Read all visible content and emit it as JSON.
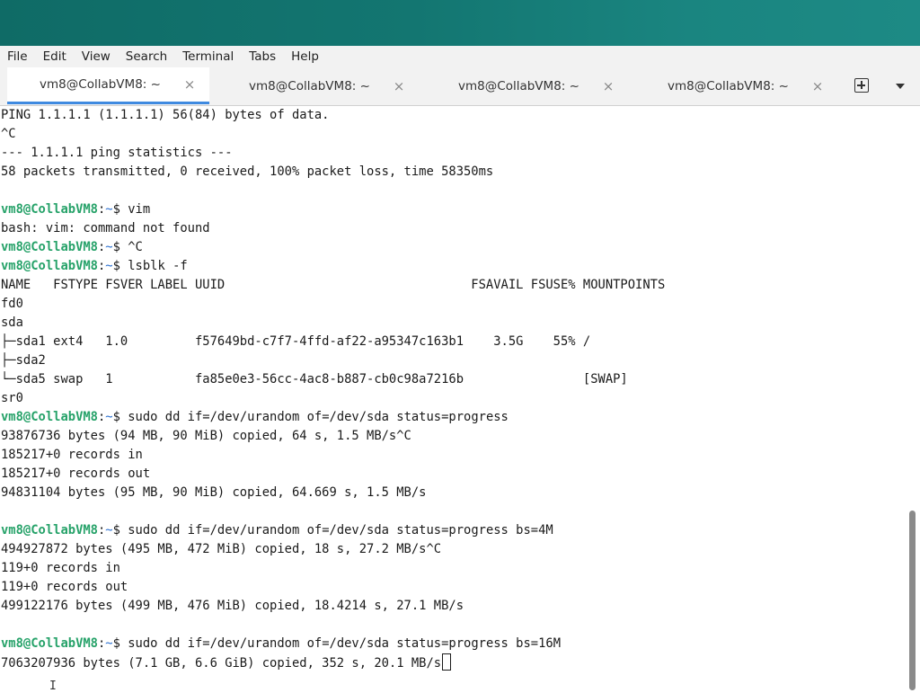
{
  "menu": [
    "File",
    "Edit",
    "View",
    "Search",
    "Terminal",
    "Tabs",
    "Help"
  ],
  "tabs": [
    {
      "label": "vm8@CollabVM8: ~",
      "active": true
    },
    {
      "label": "vm8@CollabVM8: ~",
      "active": false
    },
    {
      "label": "vm8@CollabVM8: ~",
      "active": false
    },
    {
      "label": "vm8@CollabVM8: ~",
      "active": false
    }
  ],
  "tab_close_glyph": "×",
  "icons": {
    "new_tab": "new-tab-icon",
    "tab_menu": "chevron-down-icon",
    "close": "close-icon"
  },
  "colors": {
    "accent": "#3f8ae0",
    "prompt_user": "#26a269",
    "prompt_path": "#2a6fd0",
    "titlebar": "#137671"
  },
  "prompt": {
    "user": "vm8@CollabVM8",
    "sep": ":",
    "path": "~",
    "sigil": "$ "
  },
  "terminal_lines": [
    {
      "text": "PING 1.1.1.1 (1.1.1.1) 56(84) bytes of data."
    },
    {
      "text": "^C"
    },
    {
      "text": "--- 1.1.1.1 ping statistics ---"
    },
    {
      "text": "58 packets transmitted, 0 received, 100% packet loss, time 58350ms"
    },
    {
      "text": ""
    },
    {
      "prompt": true,
      "text": "vim"
    },
    {
      "text": "bash: vim: command not found"
    },
    {
      "prompt": true,
      "text": "^C"
    },
    {
      "prompt": true,
      "text": "lsblk -f"
    },
    {
      "text": "NAME   FSTYPE FSVER LABEL UUID                                 FSAVAIL FSUSE% MOUNTPOINTS"
    },
    {
      "text": "fd0"
    },
    {
      "text": "sda"
    },
    {
      "text": "├─sda1 ext4   1.0         f57649bd-c7f7-4ffd-af22-a95347c163b1    3.5G    55% /"
    },
    {
      "text": "├─sda2"
    },
    {
      "text": "└─sda5 swap   1           fa85e0e3-56cc-4ac8-b887-cb0c98a7216b                [SWAP]"
    },
    {
      "text": "sr0"
    },
    {
      "prompt": true,
      "text": "sudo dd if=/dev/urandom of=/dev/sda status=progress"
    },
    {
      "text": "93876736 bytes (94 MB, 90 MiB) copied, 64 s, 1.5 MB/s^C"
    },
    {
      "text": "185217+0 records in"
    },
    {
      "text": "185217+0 records out"
    },
    {
      "text": "94831104 bytes (95 MB, 90 MiB) copied, 64.669 s, 1.5 MB/s"
    },
    {
      "text": ""
    },
    {
      "prompt": true,
      "text": "sudo dd if=/dev/urandom of=/dev/sda status=progress bs=4M"
    },
    {
      "text": "494927872 bytes (495 MB, 472 MiB) copied, 18 s, 27.2 MB/s^C"
    },
    {
      "text": "119+0 records in"
    },
    {
      "text": "119+0 records out"
    },
    {
      "text": "499122176 bytes (499 MB, 476 MiB) copied, 18.4214 s, 27.1 MB/s"
    },
    {
      "text": ""
    },
    {
      "prompt": true,
      "text": "sudo dd if=/dev/urandom of=/dev/sda status=progress bs=16M"
    },
    {
      "text": "7063207936 bytes (7.1 GB, 6.6 GiB) copied, 352 s, 20.1 MB/s",
      "cursor": true
    }
  ],
  "ibeam_glyph": "I"
}
